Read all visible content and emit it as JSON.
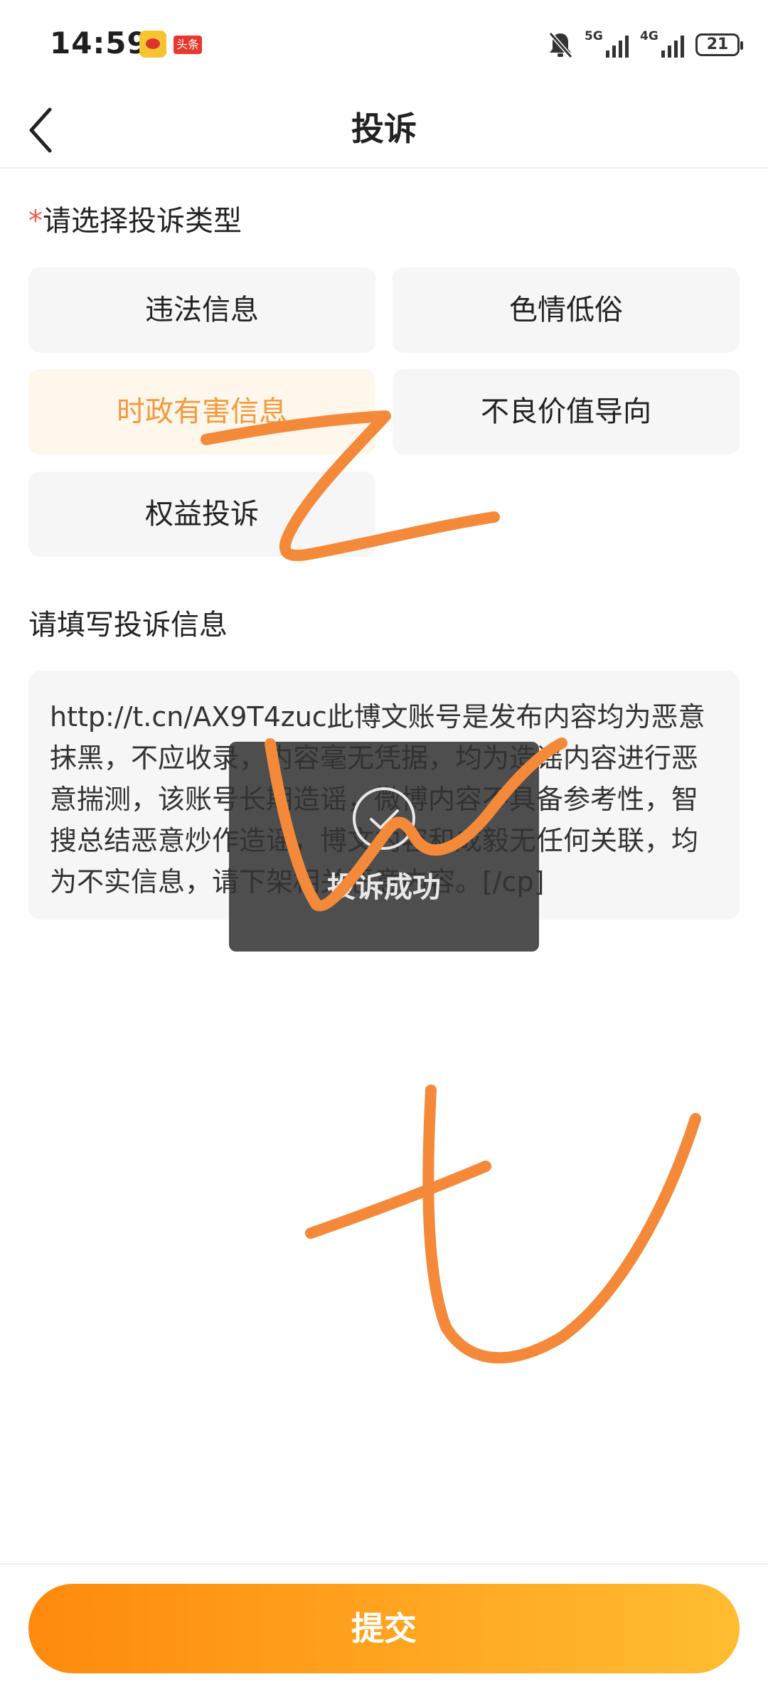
{
  "status_bar": {
    "time": "14:59",
    "toutiao_badge": "头条",
    "network_1": "5G",
    "network_2": "4G",
    "battery": "21"
  },
  "header": {
    "title": "投诉"
  },
  "complaint_type": {
    "required_mark": "*",
    "title": "请选择投诉类型",
    "options": [
      {
        "label": "违法信息",
        "selected": false
      },
      {
        "label": "色情低俗",
        "selected": false
      },
      {
        "label": "时政有害信息",
        "selected": true
      },
      {
        "label": "不良价值导向",
        "selected": false
      },
      {
        "label": "权益投诉",
        "selected": false
      }
    ],
    "selected_color": "#f39a3d"
  },
  "complaint_info": {
    "title": "请填写投诉信息",
    "text": "http://t.cn/AX9T4zuc此博文账号是发布内容均为恶意抹黑，不应收录，内容毫无凭据，均为造谣内容进行恶意揣测，该账号长期造谣，微博内容不具备参考性，智搜总结恶意炒作造谣，博文内容和成毅无任何关联，均为不实信息，请下架相关恶意内容。[/cp]"
  },
  "toast": {
    "text": "投诉成功",
    "icon": "check-circle-icon"
  },
  "submit": {
    "label": "提交",
    "gradient_start": "#ff8a0d",
    "gradient_end": "#ffbd32"
  },
  "doodle_color": "#f5893a"
}
